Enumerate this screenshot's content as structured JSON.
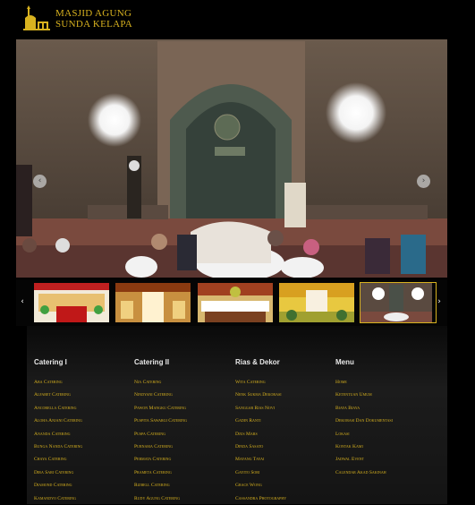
{
  "site": {
    "logo_line1": "MASJID AGUNG",
    "logo_line2": "SUNDA KELAPA",
    "accent": "#d8b21f"
  },
  "slider": {
    "prev_label": "‹",
    "next_label": "›"
  },
  "thumbnails": {
    "prev_label": "‹",
    "next_label": "›",
    "count": 5,
    "active_index": 4
  },
  "footer": {
    "columns": [
      {
        "title": "Catering I",
        "items": [
          "Aba Catering",
          "Alfabet Catering",
          "Ancorella Catering",
          "Aloha Anjani Catering",
          "Ananda Catering",
          "Bunga Nanda Catering",
          "Chaya Catering",
          "Dira Sari Catering",
          "Diamond Catering",
          "Kamandyo Catering"
        ]
      },
      {
        "title": "Catering II",
        "items": [
          "Nia Catering",
          "Nindyani Catering",
          "Pawon Mangku Catering",
          "Puspita Sawargi Catering",
          "Puspa Catering",
          "Purnama Catering",
          "Permata Catering",
          "Prameta Catering",
          "Rizbell Catering",
          "Rudy Agung Catering"
        ]
      },
      {
        "title": "Rias & Dekor",
        "items": [
          "Wita Catering",
          "Nenk Sukma Dekorasi",
          "Sanggar Rias Novi",
          "Gadin Ranti",
          "Djus Mars",
          "Dinda Sasato",
          "Mayang Tayai",
          "Gayito Sori",
          "Grace Wong",
          "Cassandra Photography"
        ]
      },
      {
        "title": "Menu",
        "items": [
          "Home",
          "Ketentuan Umum",
          "Biaya Biaya",
          "Dekorasi Dan Dokumentasi",
          "Lokasi",
          "Kontak Kami",
          "Jadwal Event",
          "Calendar Akad Sakinah"
        ]
      }
    ]
  }
}
